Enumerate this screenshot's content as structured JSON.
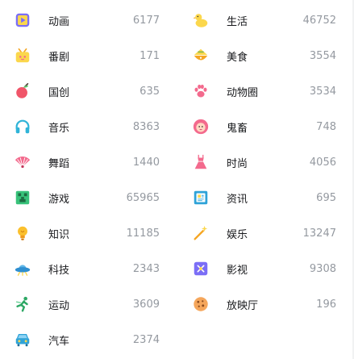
{
  "zones": {
    "left": [
      {
        "label": "动画",
        "count": "6177",
        "icon": "anime-icon"
      },
      {
        "label": "番剧",
        "count": "171",
        "icon": "tv-icon"
      },
      {
        "label": "国创",
        "count": "635",
        "icon": "chinese-anime-icon"
      },
      {
        "label": "音乐",
        "count": "8363",
        "icon": "headphones-icon"
      },
      {
        "label": "舞蹈",
        "count": "1440",
        "icon": "fan-icon"
      },
      {
        "label": "游戏",
        "count": "65965",
        "icon": "game-icon"
      },
      {
        "label": "知识",
        "count": "11185",
        "icon": "lightbulb-icon"
      },
      {
        "label": "科技",
        "count": "2343",
        "icon": "ufo-icon"
      },
      {
        "label": "运动",
        "count": "3609",
        "icon": "running-icon"
      },
      {
        "label": "汽车",
        "count": "2374",
        "icon": "car-icon"
      }
    ],
    "right": [
      {
        "label": "生活",
        "count": "46752",
        "icon": "duck-icon"
      },
      {
        "label": "美食",
        "count": "3554",
        "icon": "food-icon"
      },
      {
        "label": "动物圈",
        "count": "3534",
        "icon": "paw-icon"
      },
      {
        "label": "鬼畜",
        "count": "748",
        "icon": "lion-face-icon"
      },
      {
        "label": "时尚",
        "count": "4056",
        "icon": "dress-icon"
      },
      {
        "label": "资讯",
        "count": "695",
        "icon": "news-icon"
      },
      {
        "label": "娱乐",
        "count": "13247",
        "icon": "magic-wand-icon"
      },
      {
        "label": "影视",
        "count": "9308",
        "icon": "film-icon"
      },
      {
        "label": "放映厅",
        "count": "196",
        "icon": "cookie-icon"
      }
    ]
  },
  "colors": {
    "label": "#18191c",
    "count": "#9499a0"
  }
}
